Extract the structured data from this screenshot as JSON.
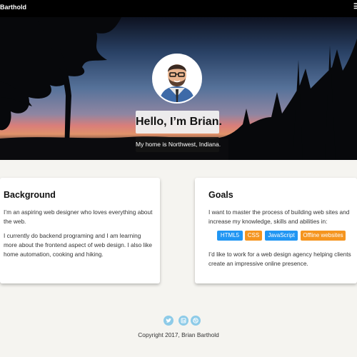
{
  "header": {
    "brand": "Barthold",
    "menu_icon": "menu-icon"
  },
  "hero": {
    "avatar_icon": "avatar-illustration",
    "title": "Hello, I’m Brian.",
    "subtitle": "My home is Northwest, Indiana."
  },
  "background": {
    "heading": "Background",
    "paragraphs": [
      "I’m an aspiring web designer who loves everything about the web.",
      "I currently do backend programing and I am learning more about the frontend aspect of web design. I also like home automation, cooking and hiking."
    ]
  },
  "goals": {
    "heading": "Goals",
    "paragraphs": [
      "I want to master the process of building web sites and increase my knowledge, skills and abilities in:",
      "I’d like to work for a web design agency helping clients create an impressive online presence."
    ],
    "skills": [
      {
        "label": "HTML5",
        "color": "#2196f3"
      },
      {
        "label": "CSS",
        "color": "#f5951f"
      },
      {
        "label": "JavaScript",
        "color": "#2196f3"
      },
      {
        "label": "Offline websites",
        "color": "#f5951f"
      }
    ]
  },
  "footer": {
    "social_icons": [
      "twitter-icon",
      "linkedin-icon",
      "dribbble-icon"
    ],
    "copyright": "Copyright 2017, Brian Barthold"
  }
}
